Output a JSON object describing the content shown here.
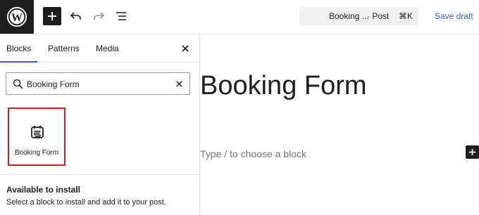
{
  "toolbar": {
    "logo_icon": "wordpress-icon",
    "inserter_icon": "plus-icon",
    "undo_icon": "undo-icon",
    "redo_icon": "redo-icon",
    "list_view_icon": "list-view-icon",
    "command": {
      "title": "Booking ...",
      "type": "· Post",
      "shortcut": "⌘K"
    },
    "save_draft_label": "Save draft"
  },
  "inserter": {
    "tabs": [
      {
        "label": "Blocks",
        "active": true
      },
      {
        "label": "Patterns",
        "active": false
      },
      {
        "label": "Media",
        "active": false
      }
    ],
    "close_icon": "close-icon",
    "search": {
      "value": "Booking Form",
      "placeholder": "Search",
      "clear_icon": "close-icon"
    },
    "results": [
      {
        "label": "Booking Form",
        "icon": "calendar-form-icon",
        "highlighted": true
      }
    ],
    "install": {
      "title": "Available to install",
      "description": "Select a block to install and add it to your post."
    }
  },
  "editor": {
    "post_title": "Booking Form",
    "placeholder": "Type / to choose a block",
    "appender_icon": "plus-icon"
  },
  "colors": {
    "dark": "#1e1e1e",
    "accent": "#3858e9",
    "highlight_border": "#e11d1d",
    "placeholder_text": "#757575"
  }
}
